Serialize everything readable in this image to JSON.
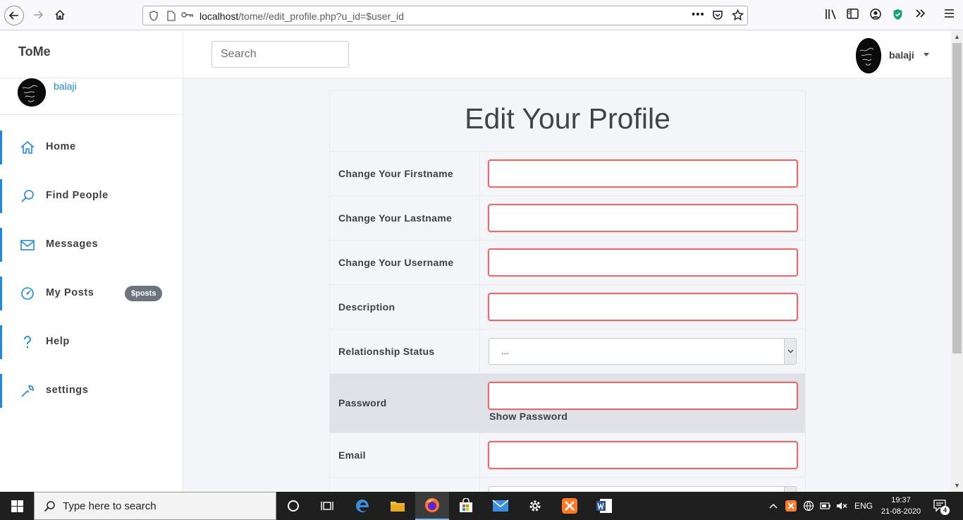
{
  "browser": {
    "url_host": "localhost",
    "url_path": "/tome//edit_profile.php?u_id=$user_id",
    "more_label": "•••"
  },
  "navbar": {
    "brand": "ToMe",
    "search_placeholder": "Search",
    "username": "balaji"
  },
  "sidebar": {
    "username": "balaji",
    "items": [
      {
        "label": "Home",
        "icon": "home-icon"
      },
      {
        "label": "Find People",
        "icon": "search-icon"
      },
      {
        "label": "Messages",
        "icon": "mail-icon"
      },
      {
        "label": "My Posts",
        "icon": "gauge-icon",
        "badge": "$posts"
      },
      {
        "label": "Help",
        "icon": "help-icon"
      },
      {
        "label": "settings",
        "icon": "wrench-icon"
      }
    ]
  },
  "form": {
    "title": "Edit Your Profile",
    "firstname_label": "Change Your Firstname",
    "lastname_label": "Change Your Lastname",
    "username_label": "Change Your Username",
    "description_label": "Description",
    "relationship_label": "Relationship Status",
    "relationship_value": "...",
    "password_label": "Password",
    "show_password_label": "Show Password",
    "email_label": "Email"
  },
  "taskbar": {
    "search_placeholder": "Type here to search",
    "language": "ENG",
    "time": "19:37",
    "date": "21-08-2020",
    "notification_count": "4"
  },
  "colors": {
    "accent": "#1e88e5",
    "input_error_border": "#e86a6a",
    "badge_bg": "#6c757d"
  }
}
